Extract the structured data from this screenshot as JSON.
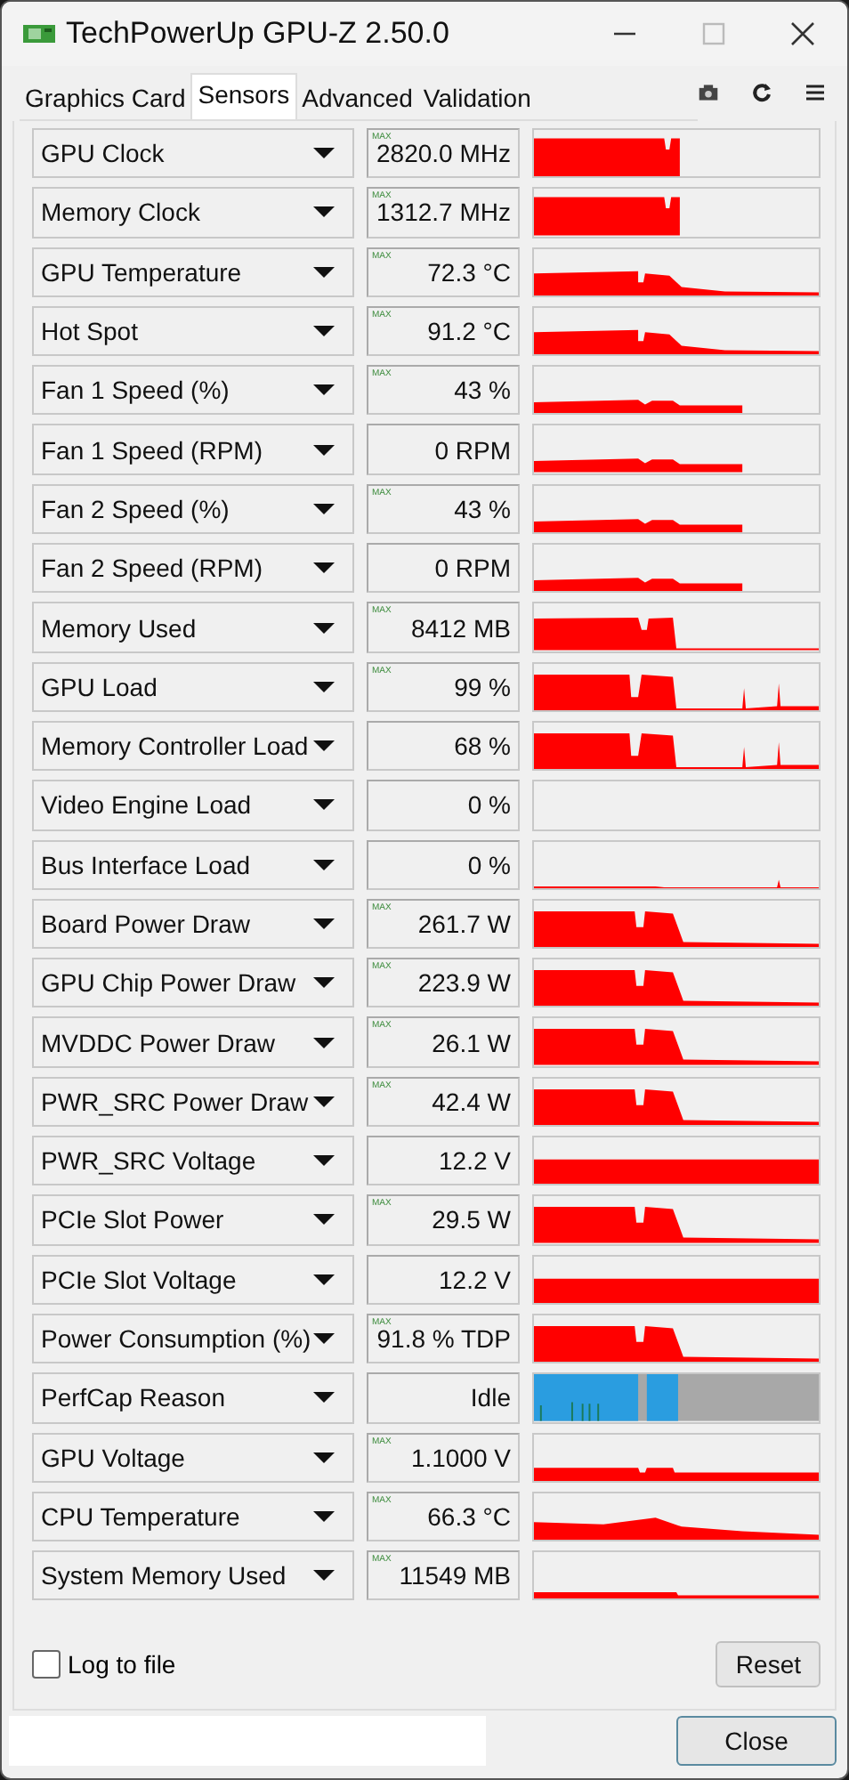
{
  "window": {
    "title": "TechPowerUp GPU-Z 2.50.0"
  },
  "tabs": [
    {
      "label": "Graphics Card",
      "selected": false
    },
    {
      "label": "Sensors",
      "selected": true
    },
    {
      "label": "Advanced",
      "selected": false
    },
    {
      "label": "Validation",
      "selected": false
    }
  ],
  "sensors": [
    {
      "name": "GPU Clock",
      "badge": "MAX",
      "value": "2820.0 MHz",
      "kind": "clock"
    },
    {
      "name": "Memory Clock",
      "badge": "MAX",
      "value": "1312.7 MHz",
      "kind": "clock"
    },
    {
      "name": "GPU Temperature",
      "badge": "MAX",
      "value": "72.3 °C",
      "kind": "temp"
    },
    {
      "name": "Hot Spot",
      "badge": "MAX",
      "value": "91.2 °C",
      "kind": "temp"
    },
    {
      "name": "Fan 1 Speed (%)",
      "badge": "MAX",
      "value": "43 %",
      "kind": "fan"
    },
    {
      "name": "Fan 1 Speed (RPM)",
      "value": "0 RPM",
      "kind": "fan"
    },
    {
      "name": "Fan 2 Speed (%)",
      "badge": "MAX",
      "value": "43 %",
      "kind": "fan"
    },
    {
      "name": "Fan 2 Speed (RPM)",
      "value": "0 RPM",
      "kind": "fan"
    },
    {
      "name": "Memory Used",
      "badge": "MAX",
      "value": "8412 MB",
      "kind": "memory"
    },
    {
      "name": "GPU Load",
      "badge": "MAX",
      "value": "99 %",
      "kind": "load"
    },
    {
      "name": "Memory Controller Load",
      "value": "68 %",
      "kind": "load"
    },
    {
      "name": "Video Engine Load",
      "value": "0 %",
      "kind": "empty"
    },
    {
      "name": "Bus Interface Load",
      "value": "0 %",
      "kind": "bus"
    },
    {
      "name": "Board Power Draw",
      "badge": "MAX",
      "value": "261.7 W",
      "kind": "power"
    },
    {
      "name": "GPU Chip Power Draw",
      "badge": "MAX",
      "value": "223.9 W",
      "kind": "power"
    },
    {
      "name": "MVDDC Power Draw",
      "badge": "MAX",
      "value": "26.1 W",
      "kind": "power"
    },
    {
      "name": "PWR_SRC Power Draw",
      "badge": "MAX",
      "value": "42.4 W",
      "kind": "power"
    },
    {
      "name": "PWR_SRC Voltage",
      "value": "12.2 V",
      "kind": "full"
    },
    {
      "name": "PCIe Slot Power",
      "badge": "MAX",
      "value": "29.5 W",
      "kind": "power"
    },
    {
      "name": "PCIe Slot Voltage",
      "value": "12.2 V",
      "kind": "full"
    },
    {
      "name": "Power Consumption (%)",
      "badge": "MAX",
      "value": "91.8 % TDP",
      "kind": "power"
    },
    {
      "name": "PerfCap Reason",
      "value": "Idle",
      "kind": "perfcap"
    },
    {
      "name": "GPU Voltage",
      "badge": "MAX",
      "value": "1.1000 V",
      "kind": "voltage"
    },
    {
      "name": "CPU Temperature",
      "badge": "MAX",
      "value": "66.3 °C",
      "kind": "cputemp"
    },
    {
      "name": "System Memory Used",
      "badge": "MAX",
      "value": "11549 MB",
      "kind": "sysmem"
    }
  ],
  "log_to_file": {
    "label": "Log to file",
    "checked": false
  },
  "buttons": {
    "reset": "Reset",
    "close": "Close"
  }
}
